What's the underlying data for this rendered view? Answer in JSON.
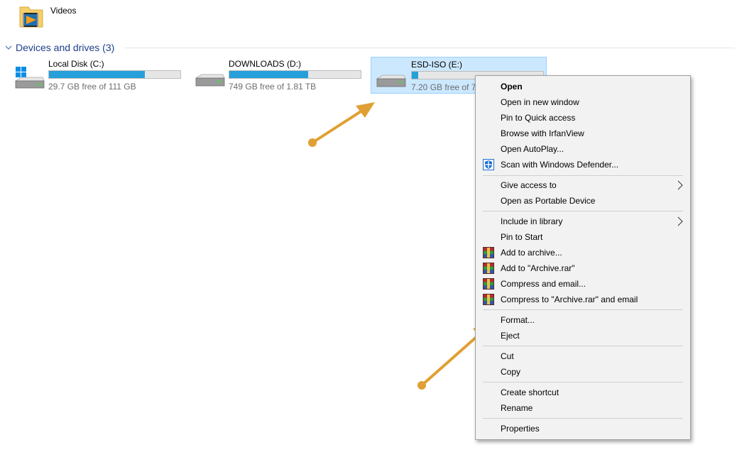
{
  "folder": {
    "label": "Videos",
    "icon": "video-folder-icon"
  },
  "group": {
    "title": "Devices and drives (3)"
  },
  "drives": [
    {
      "name": "Local Disk (C:)",
      "free_text": "29.7 GB free of 111 GB",
      "used_fraction": 0.73,
      "icon": "windows-drive-icon"
    },
    {
      "name": "DOWNLOADS (D:)",
      "free_text": "749 GB free of 1.81 TB",
      "used_fraction": 0.6,
      "icon": "hard-drive-icon"
    },
    {
      "name": "ESD-ISO (E:)",
      "free_text": "7.20 GB free of 7.",
      "used_fraction": 0.05,
      "icon": "hard-drive-icon",
      "selected": true
    }
  ],
  "menu": {
    "items": [
      {
        "label": "Open",
        "bold": true
      },
      {
        "label": "Open in new window"
      },
      {
        "label": "Pin to Quick access"
      },
      {
        "label": "Browse with IrfanView"
      },
      {
        "label": "Open AutoPlay..."
      },
      {
        "label": "Scan with Windows Defender...",
        "icon": "windows-defender-icon"
      },
      {
        "label": "Give access to",
        "submenu": true
      },
      {
        "label": "Open as Portable Device"
      },
      {
        "label": "Include in library",
        "submenu": true
      },
      {
        "label": "Pin to Start"
      },
      {
        "label": "Add to archive...",
        "icon": "winrar-icon"
      },
      {
        "label": "Add to \"Archive.rar\"",
        "icon": "winrar-icon"
      },
      {
        "label": "Compress and email...",
        "icon": "winrar-icon"
      },
      {
        "label": "Compress to \"Archive.rar\" and email",
        "icon": "winrar-icon"
      },
      {
        "label": "Format..."
      },
      {
        "label": "Eject"
      },
      {
        "label": "Cut"
      },
      {
        "label": "Copy"
      },
      {
        "label": "Create shortcut"
      },
      {
        "label": "Rename"
      },
      {
        "label": "Properties"
      }
    ]
  },
  "colors": {
    "accent": "#26a0da",
    "selection": "#cce8ff",
    "arrow": "#e0a033",
    "group_header": "#1e3f8c"
  }
}
